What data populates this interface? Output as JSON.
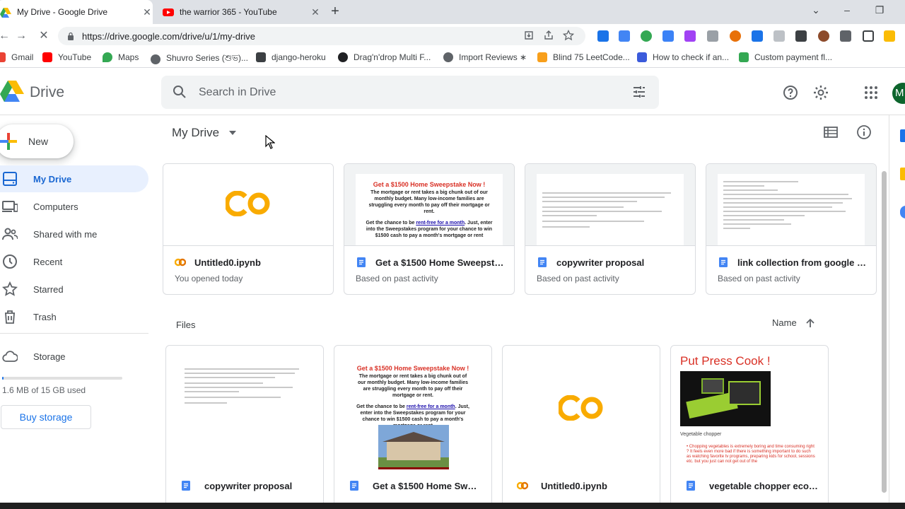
{
  "browser": {
    "tabs": [
      {
        "title": "My Drive - Google Drive",
        "active": true
      },
      {
        "title": "the warrior 365 - YouTube",
        "active": false
      }
    ],
    "url": "https://drive.google.com/drive/u/1/my-drive",
    "bookmarks": [
      {
        "label": "Gmail"
      },
      {
        "label": "YouTube"
      },
      {
        "label": "Maps"
      },
      {
        "label": "Shuvro Series (শুভ)..."
      },
      {
        "label": "django-heroku"
      },
      {
        "label": "Drag'n'drop Multi F..."
      },
      {
        "label": "Import Reviews ∗"
      },
      {
        "label": "Blind 75 LeetCode..."
      },
      {
        "label": "How to check if an..."
      },
      {
        "label": "Custom payment fl..."
      }
    ]
  },
  "drive": {
    "brand": "Drive",
    "search_placeholder": "Search in Drive",
    "avatar_letter": "M",
    "new_label": "New",
    "nav": [
      {
        "label": "My Drive",
        "icon": "my-drive-icon",
        "active": true
      },
      {
        "label": "Computers",
        "icon": "computers-icon"
      },
      {
        "label": "Shared with me",
        "icon": "shared-icon"
      },
      {
        "label": "Recent",
        "icon": "clock-icon"
      },
      {
        "label": "Starred",
        "icon": "star-icon"
      },
      {
        "label": "Trash",
        "icon": "trash-icon"
      },
      {
        "label": "Storage",
        "icon": "cloud-icon"
      }
    ],
    "storage_text": "1.6 MB of 15 GB used",
    "storage_used_fraction": 0.0001,
    "buy_storage": "Buy storage",
    "breadcrumb": "My Drive",
    "suggested": [
      {
        "name": "Untitled0.ipynb",
        "sub": "You opened today",
        "type": "colab"
      },
      {
        "name": "Get a $1500 Home Sweepstake Now !",
        "sub": "Based on past activity",
        "type": "doc"
      },
      {
        "name": "copywriter proposal",
        "sub": "Based on past activity",
        "type": "doc"
      },
      {
        "name": "link collection from google search",
        "sub": "Based on past activity",
        "type": "doc"
      }
    ],
    "files_label": "Files",
    "sort_label": "Name",
    "files": [
      {
        "name": "copywriter proposal",
        "type": "doc"
      },
      {
        "name": "Get a $1500 Home Sweepstake Now !",
        "type": "doc"
      },
      {
        "name": "Untitled0.ipynb",
        "type": "colab"
      },
      {
        "name": "vegetable chopper ecommerce",
        "type": "doc"
      }
    ],
    "sweepstake_doc": {
      "heading": "Get a $1500 Home Sweepstake Now !",
      "body": "The mortgage or rent takes a big chunk out of our monthly budget. Many low-income families are struggling every month to pay off their mortgage or rent.",
      "cta_prefix": "Get the chance to be ",
      "cta_link": "rent-free for a month",
      "cta_suffix": ". Just, enter into the Sweepstakes program for your chance to win $1500 cash to pay a month's mortgage or rent"
    },
    "chopper_doc": {
      "heading": "Put Press Cook !",
      "caption": "Vegetable chopper",
      "bullet": "Chopping vegetables is extremely boring and time consuming right ? It feels even more bad if there is something important to do such as watching favorite tv programs, preparing kids for school, sessions etc. but you just can not get out of the"
    },
    "colors": {
      "accent": "#1a73e8",
      "active_bg": "#e8f0fe",
      "doc_blue": "#4285f4",
      "colab_orange": "#f9ab00"
    }
  }
}
